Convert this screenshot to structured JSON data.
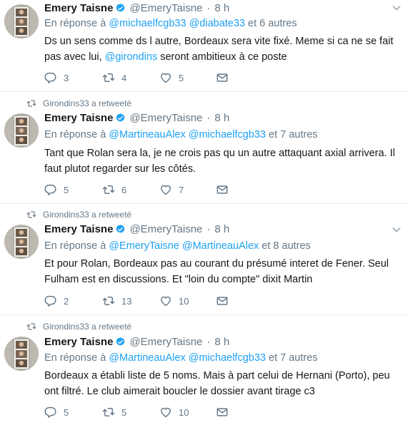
{
  "user": {
    "name": "Emery Taisne",
    "handle": "@EmeryTaisne"
  },
  "retweeter_text": "Girondins33 a retweeté",
  "reply_prefix": "En réponse à",
  "colors": {
    "link": "#1da1f2",
    "muted": "#657786",
    "verified": "#1da1f2",
    "divider": "#e6ecf0"
  },
  "tweets": [
    {
      "time": "8 h",
      "reply_to": [
        "@michaelfcgb33",
        "@diabate33"
      ],
      "reply_more": "et 6 autres",
      "text_a": "Ds un sens comme ds l autre, Bordeaux sera vite fixé. Meme si ca ne se fait pas avec lui, ",
      "text_mention": "@girondins",
      "text_b": " seront ambitieux à ce poste",
      "replies": "3",
      "retweets": "4",
      "likes": "5"
    },
    {
      "time": "8 h",
      "reply_to": [
        "@MartineauAlex",
        "@michaelfcgb33"
      ],
      "reply_more": "et 7 autres",
      "text": "Tant que Rolan sera la, je ne crois pas qu un autre attaquant axial arrivera. Il faut plutot regarder sur les côtés.",
      "replies": "5",
      "retweets": "6",
      "likes": "7"
    },
    {
      "time": "8 h",
      "reply_to": [
        "@EmeryTaisne",
        "@MartineauAlex"
      ],
      "reply_more": "et 8 autres",
      "text": "Et pour Rolan, Bordeaux pas au courant du présumé interet de Fener. Seul Fulham est en discussions. Et \"loin du compte\" dixit Martin",
      "replies": "2",
      "retweets": "13",
      "likes": "10"
    },
    {
      "time": "8 h",
      "reply_to": [
        "@MartineauAlex",
        "@michaelfcgb33"
      ],
      "reply_more": "et 7 autres",
      "text": "Bordeaux a établi liste de 5 noms. Mais à part celui de Hernani (Porto), peu ont filtré. Le club aimerait boucler le dossier avant tirage c3",
      "replies": "5",
      "retweets": "5",
      "likes": "10"
    }
  ]
}
